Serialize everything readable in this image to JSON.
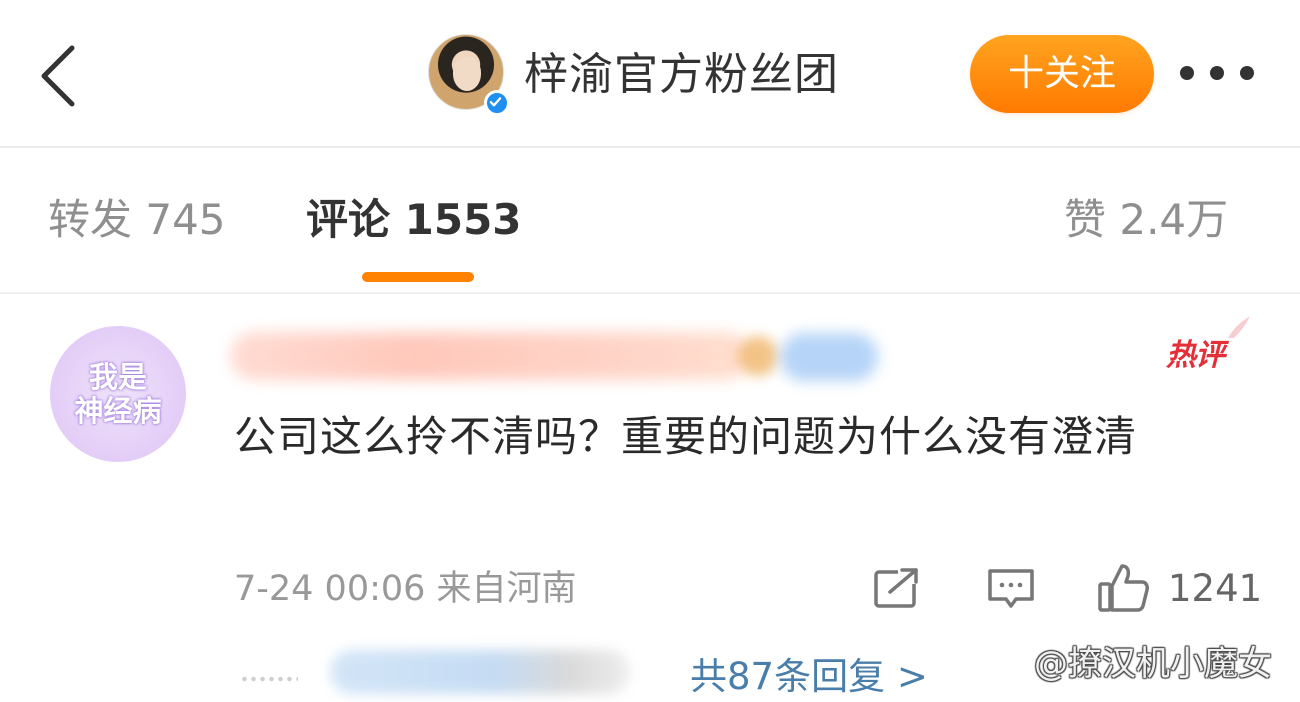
{
  "header": {
    "account_name": "梓渝官方粉丝团",
    "follow_label": "十关注"
  },
  "tabs": [
    {
      "label": "转发 745",
      "active": false
    },
    {
      "label": "评论 1553",
      "active": true
    },
    {
      "label": "赞 2.4万",
      "active": false
    }
  ],
  "comment": {
    "avatar_text_line1": "我是",
    "avatar_text_line2": "神经病",
    "hot_badge": "热评",
    "text": "公司这么拎不清吗？重要的问题为什么没有澄清",
    "meta": "7-24 00:06 来自河南",
    "likes": "1241",
    "replies_label": "共87条回复 >"
  },
  "watermark": "@撩汉机小魔女",
  "colors": {
    "accent": "#ff8200",
    "follow_gradient_top": "#ffa420",
    "follow_gradient_bottom": "#ff7a00",
    "link": "#4a7eaa",
    "hot": "#e52f38",
    "verified": "#1f8ff2"
  },
  "icons": {
    "back": "chevron-left-icon",
    "more": "more-dots-icon",
    "share": "share-icon",
    "reply": "reply-icon",
    "like": "thumbs-up-icon",
    "verified": "verified-badge-icon"
  }
}
